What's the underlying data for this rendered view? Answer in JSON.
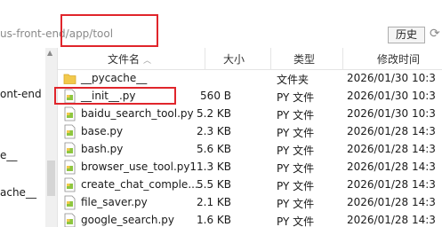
{
  "address_bar": {
    "path": "us-front-end/app/tool",
    "history_label": "历史",
    "refresh_icon": "refresh-icon"
  },
  "left_nav": {
    "items": [
      {
        "label": "ont-end"
      },
      {
        "label": "e__"
      },
      {
        "label": "ache__"
      }
    ]
  },
  "columns": {
    "name": "文件名",
    "size": "大小",
    "type": "类型",
    "modified": "修改时间"
  },
  "files": [
    {
      "name": "__pycache__",
      "size": "",
      "type": "文件夹",
      "modified": "2026/01/30 10:3",
      "icon": "folder-icon"
    },
    {
      "name": "__init__.py",
      "size": "560 B",
      "type": "PY 文件",
      "modified": "2026/01/30 10:3",
      "icon": "python-file-icon"
    },
    {
      "name": "baidu_search_tool.py",
      "size": "5.2 KB",
      "type": "PY 文件",
      "modified": "2026/01/30 10:3",
      "icon": "python-file-icon"
    },
    {
      "name": "base.py",
      "size": "2.3 KB",
      "type": "PY 文件",
      "modified": "2026/01/28 14:3",
      "icon": "python-file-icon"
    },
    {
      "name": "bash.py",
      "size": "5.6 KB",
      "type": "PY 文件",
      "modified": "2026/01/28 14:3",
      "icon": "python-file-icon"
    },
    {
      "name": "browser_use_tool.py",
      "size": "11.3 KB",
      "type": "PY 文件",
      "modified": "2026/01/28 14:3",
      "icon": "python-file-icon"
    },
    {
      "name": "create_chat_comple...",
      "size": "5.5 KB",
      "type": "PY 文件",
      "modified": "2026/01/28 14:3",
      "icon": "python-file-icon"
    },
    {
      "name": "file_saver.py",
      "size": "2.1 KB",
      "type": "PY 文件",
      "modified": "2026/01/28 14:3",
      "icon": "python-file-icon"
    },
    {
      "name": "google_search.py",
      "size": "1.6 KB",
      "type": "PY 文件",
      "modified": "2026/01/28 14:3",
      "icon": "python-file-icon"
    }
  ],
  "colors": {
    "annotation": "#e0252b",
    "folder": "#f2c94c"
  }
}
